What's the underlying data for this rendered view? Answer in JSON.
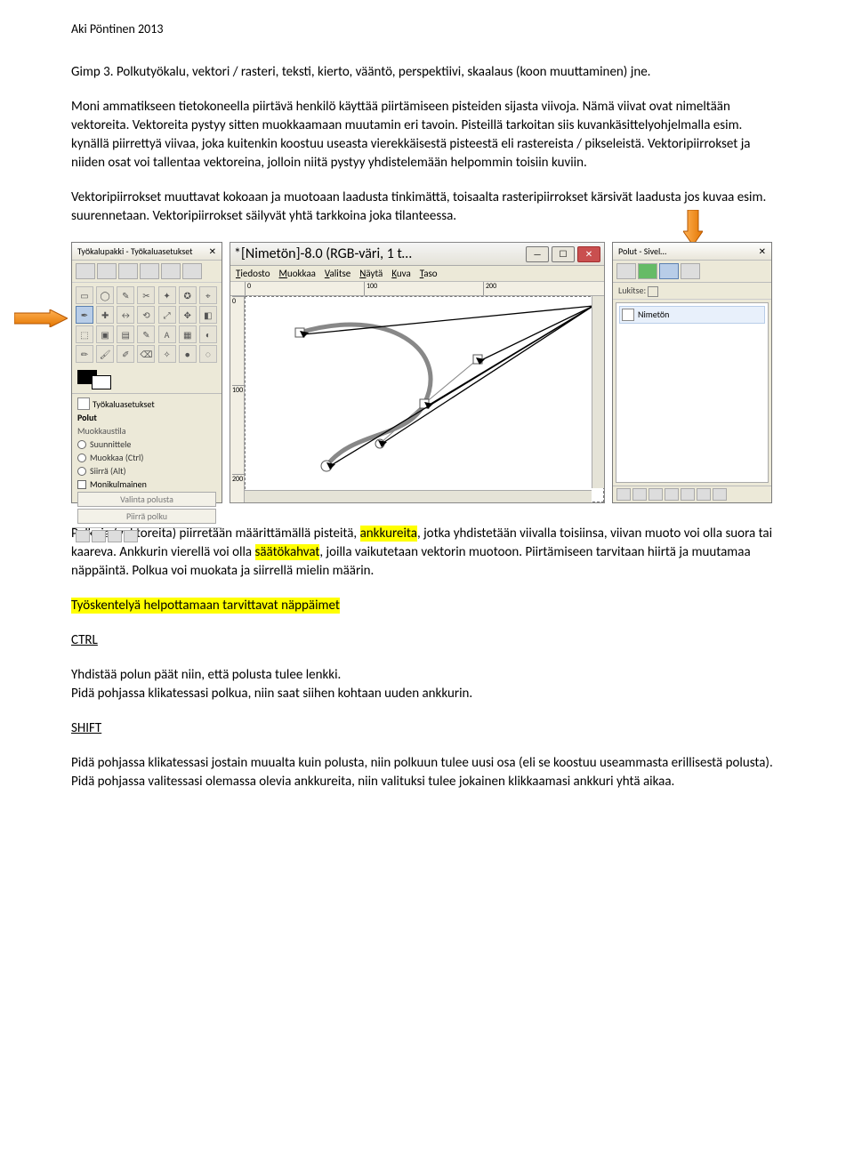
{
  "header": "Aki Pöntinen 2013",
  "p1": "Gimp 3. Polkutyökalu, vektori / rasteri, teksti, kierto, vääntö, perspektiivi, skaalaus (koon muuttaminen)  jne.",
  "p2": "Moni ammatikseen tietokoneella piirtävä henkilö käyttää piirtämiseen pisteiden sijasta viivoja. Nämä viivat ovat nimeltään vektoreita. Vektoreita pystyy sitten muokkaamaan muutamin eri tavoin. Pisteillä tarkoitan siis kuvankäsittelyohjelmalla esim. kynällä piirrettyä viivaa, joka kuitenkin koostuu useasta vierekkäisestä pisteestä eli rastereista / pikseleistä. Vektoripiirrokset ja niiden osat voi tallentaa vektoreina, jolloin niitä pystyy yhdistelemään helpommin toisiin kuviin.",
  "p3": "Vektoripiirrokset muuttavat kokoaan ja muotoaan laadusta tinkimättä, toisaalta rasteripiirrokset kärsivät laadusta jos kuvaa esim. suurennetaan. Vektoripiirrokset säilyvät yhtä tarkkoina joka tilanteessa.",
  "after_a": "Polkuja (vektoreita) piirretään määrittämällä pisteitä, ",
  "after_b": "ankkureita",
  "after_c": ", jotka yhdistetään viivalla toisiinsa, viivan muoto voi olla suora tai kaareva. Ankkurin vierellä voi olla ",
  "after_d": "säätökahvat",
  "after_e": ", joilla vaikutetaan vektorin muotoon. Piirtämiseen tarvitaan hiirtä ja muutamaa näppäintä. Polkua voi muokata ja siirrellä mielin määrin.",
  "hint_heading": "Työskentelyä helpottamaan tarvittavat näppäimet",
  "ctrl_label": "CTRL",
  "ctrl_text": "Yhdistää polun päät niin, että polusta tulee lenkki.\nPidä pohjassa klikatessasi polkua, niin saat siihen kohtaan uuden ankkurin.",
  "shift_label": "SHIFT",
  "shift_text": "Pidä pohjassa klikatessasi jostain muualta kuin polusta, niin polkuun tulee uusi osa (eli se koostuu useammasta erillisestä polusta).\nPidä pohjassa valitessasi olemassa olevia ankkureita, niin valituksi tulee jokainen klikkaamasi ankkuri yhtä aikaa.",
  "toolbox": {
    "title": "Työkalupakki - Työkaluasetukset",
    "optlabel": "Työkaluasetukset",
    "section": "Polut",
    "modelabel": "Muokkaustila",
    "r1": "Suunnittele",
    "r2": "Muokkaa (Ctrl)",
    "r3": "Siirrä (Alt)",
    "chk": "Monikulmainen",
    "btn1": "Valinta polusta",
    "btn2": "Piirrä polku"
  },
  "canvas": {
    "title": "*[Nimetön]-8.0 (RGB-väri, 1 t…",
    "menu": [
      "Tiedosto",
      "Muokkaa",
      "Valitse",
      "Näytä",
      "Kuva",
      "Taso"
    ],
    "ticks_top": [
      "0",
      "100",
      "200"
    ],
    "ticks_left": [
      "0",
      "100",
      "200"
    ]
  },
  "pathspanel": {
    "title": "Polut - Sivel…",
    "lock": "Lukitse:",
    "item": "Nimetön"
  }
}
